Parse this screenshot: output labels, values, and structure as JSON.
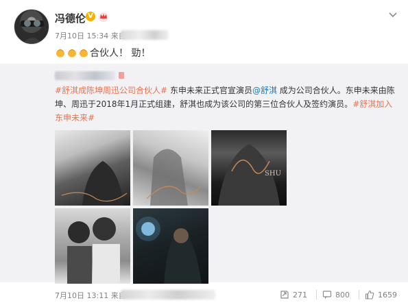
{
  "post": {
    "author": "冯德伦",
    "verified_badge": "V",
    "time": "7月10日 15:34 来自",
    "text": "合伙人！ 勁！"
  },
  "repost": {
    "text_parts": {
      "tag1": "#舒淇成陈坤周迅公司合伙人#",
      "t1": " 东申未来正式官宣演员",
      "mention": "@舒淇",
      "t2": " 成为公司合伙人。东申未来由陈坤、周迅于2018年1月正式组建，舒淇也成为该公司的第三位合伙人及签约演员。",
      "tag2": "#舒淇加入东申未来#"
    },
    "photo3_watermark": "SHU"
  },
  "footer": {
    "time": "7月10日 13:11 来自",
    "repost_count": "271",
    "comment_count": "800",
    "like_count": "1659"
  },
  "colors": {
    "link": "#1a7bb8",
    "tag": "#eb7350",
    "repost_bg": "#f2f2f5",
    "badge": "#f6b100"
  },
  "icons": [
    "clap-icon",
    "chevron-down-icon",
    "crown-icon",
    "repost-icon",
    "comment-icon",
    "like-icon"
  ]
}
